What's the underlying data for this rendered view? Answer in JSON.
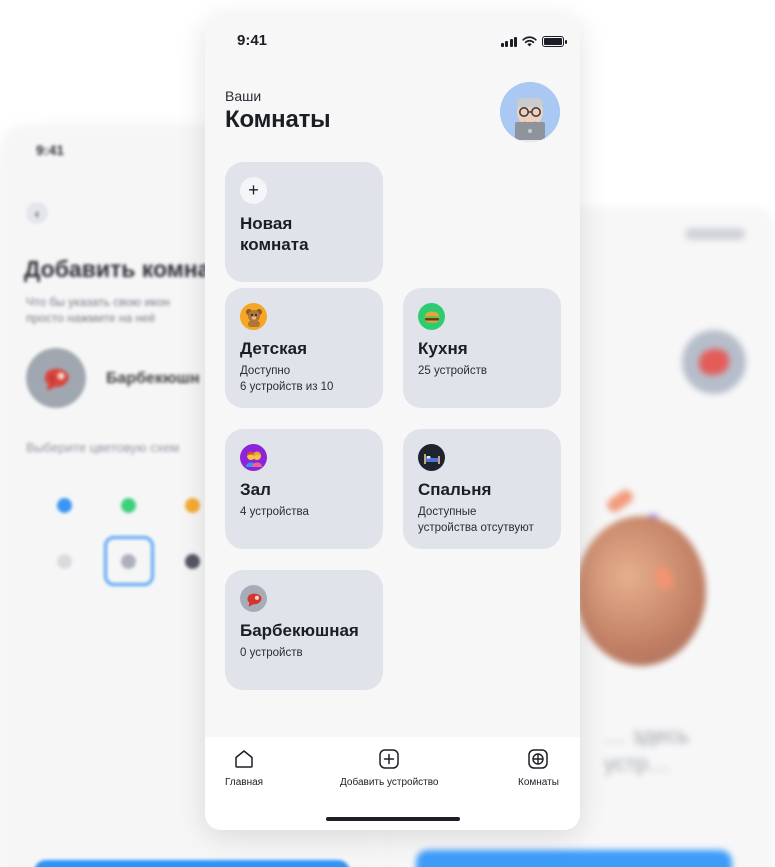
{
  "background_left": {
    "status_time": "9:41",
    "title": "Добавить комна",
    "hint_line1": "Что бы указать свою икон",
    "hint_line2": "просто нажмите на неё",
    "room_name": "Барбекюшн",
    "scheme_label": "Выберите цветовую схем",
    "colors": [
      "#2a8df5",
      "#2ecc71",
      "#f5a623",
      "#d7d9de",
      "#a6abb4",
      "#454a54"
    ]
  },
  "background_right": {
    "text_line1": "… здесь",
    "text_line2": "устр…"
  },
  "status_bar": {
    "time": "9:41"
  },
  "header": {
    "greeting": "Ваши",
    "title": "Комнаты",
    "avatar_icon": "memoji-avatar-icon"
  },
  "new_room": {
    "icon": "plus-icon",
    "title_line1": "Новая",
    "title_line2": "комната"
  },
  "rooms": [
    {
      "icon": "teddy-bear-icon",
      "icon_bg": "#f5a623",
      "title": "Детская",
      "line1": "Доступно",
      "line2": "6 устройств из 10"
    },
    {
      "icon": "burger-icon",
      "icon_bg": "#2ecc71",
      "title": "Кухня",
      "line1": "25 устройств",
      "line2": ""
    },
    {
      "icon": "people-icon",
      "icon_bg": "#8e24d9",
      "title": "Зал",
      "line1": "4 устройства",
      "line2": ""
    },
    {
      "icon": "bed-icon",
      "icon_bg": "#1f2330",
      "title": "Спальня",
      "line1": "Доступные",
      "line2": "устройства отсутвуют"
    },
    {
      "icon": "steak-icon",
      "icon_bg": "#a7adb8",
      "title": "Барбекюшная",
      "line1": "0 устройств",
      "line2": ""
    }
  ],
  "tabbar": {
    "home": "Главная",
    "add_device": "Добавить устройство",
    "rooms": "Комнаты"
  }
}
